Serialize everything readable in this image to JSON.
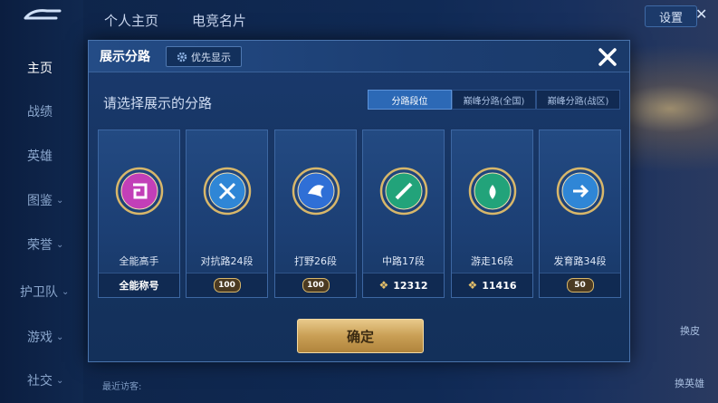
{
  "nav": {
    "items": [
      {
        "label": "主页",
        "active": true
      },
      {
        "label": "战绩"
      },
      {
        "label": "英雄"
      },
      {
        "label": "图鉴",
        "chevron": true
      },
      {
        "label": "荣誉",
        "chevron": true
      },
      {
        "label": "护卫队",
        "chevron": true
      },
      {
        "label": "游戏",
        "chevron": true
      },
      {
        "label": "社交",
        "chevron": true
      }
    ]
  },
  "top_tabs": [
    "个人主页",
    "电竞名片"
  ],
  "settings_label": "设置",
  "bottom_hint": "最近访客:",
  "right_labels": [
    "换皮",
    "换英雄"
  ],
  "dialog": {
    "title": "展示分路",
    "priority_label": "优先显示",
    "prompt": "请选择展示的分路",
    "segments": [
      "分路段位",
      "巅峰分路(全国)",
      "巅峰分路(战区)"
    ],
    "active_segment": 0,
    "confirm_label": "确定"
  },
  "cards": [
    {
      "name": "全能高手",
      "footer": "全能称号",
      "footer_type": "text",
      "emblem_color": "#c23fb8",
      "emblem_symbol": "spiral"
    },
    {
      "name": "对抗路24段",
      "footer": "100",
      "footer_type": "plate",
      "emblem_color": "#2f86d6",
      "emblem_symbol": "cross"
    },
    {
      "name": "打野26段",
      "footer": "100",
      "footer_type": "plate",
      "emblem_color": "#2f6fd6",
      "emblem_symbol": "wolf"
    },
    {
      "name": "中路17段",
      "footer": "12312",
      "footer_type": "points",
      "emblem_color": "#22a37a",
      "emblem_symbol": "slash"
    },
    {
      "name": "游走16段",
      "footer": "11416",
      "footer_type": "points",
      "emblem_color": "#22a37a",
      "emblem_symbol": "leaf"
    },
    {
      "name": "发育路34段",
      "footer": "50",
      "footer_type": "plate",
      "emblem_color": "#2f86d6",
      "emblem_symbol": "arrow"
    }
  ],
  "colors": {
    "gold": "#d8b76a",
    "accent": "#2c69b6"
  }
}
